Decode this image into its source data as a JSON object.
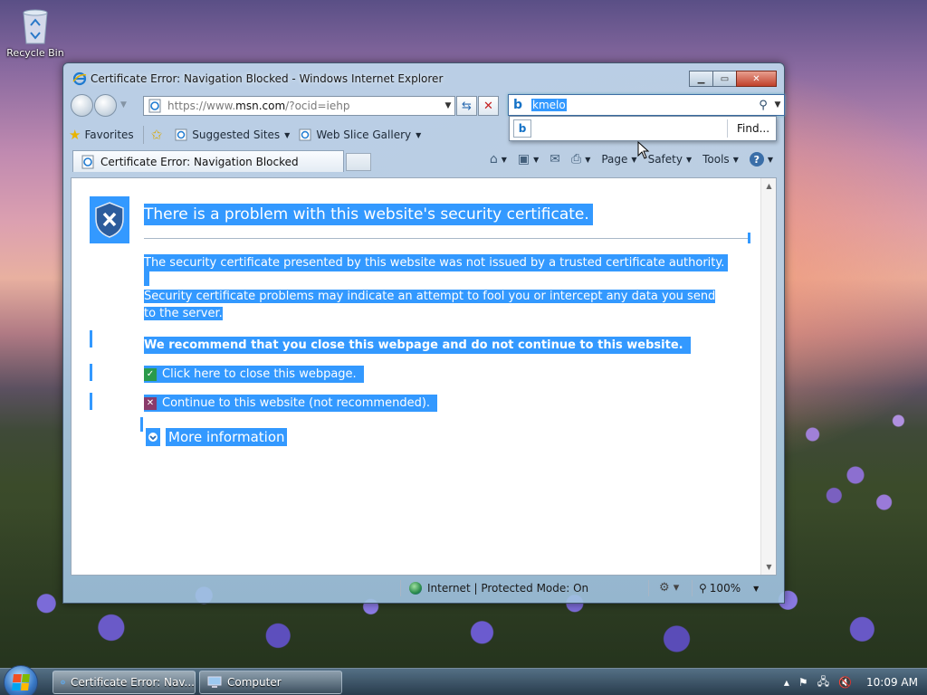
{
  "desktop": {
    "icon_label": "Recycle Bin"
  },
  "window": {
    "title": "Certificate Error: Navigation Blocked - Windows Internet Explorer",
    "address": {
      "url_prefix": "https://www.",
      "url_host": "msn.com",
      "url_suffix": "/?ocid=iehp"
    },
    "search": {
      "query": "kmelo",
      "find_label": "Find..."
    },
    "favorites_bar": {
      "favorites_label": "Favorites",
      "suggested_sites_label": "Suggested Sites",
      "web_slice_label": "Web Slice Gallery"
    },
    "tab": {
      "title": "Certificate Error: Navigation Blocked"
    },
    "command_bar": {
      "page_label": "Page",
      "safety_label": "Safety",
      "tools_label": "Tools"
    },
    "page": {
      "heading": "There is a problem with this website's security certificate.",
      "paragraph1": "The security certificate presented by this website was not issued by a trusted certificate authority.",
      "paragraph2": "Security certificate problems may indicate an attempt to fool you or intercept any data you send to the server.",
      "recommendation": "We recommend that you close this webpage and do not continue to this website.",
      "close_link": "Click here to close this webpage.",
      "continue_link": "Continue to this website (not recommended).",
      "more_info": "More information"
    },
    "status_bar": {
      "zone_text": "Internet | Protected Mode: On",
      "zoom": "100%"
    }
  },
  "taskbar": {
    "items": [
      {
        "label": "Certificate Error: Nav..."
      },
      {
        "label": "Computer"
      }
    ],
    "clock": "10:09 AM"
  },
  "colors": {
    "selection": "#3399ff",
    "bing_blue": "#1572c6",
    "stop_red": "#c42020"
  }
}
